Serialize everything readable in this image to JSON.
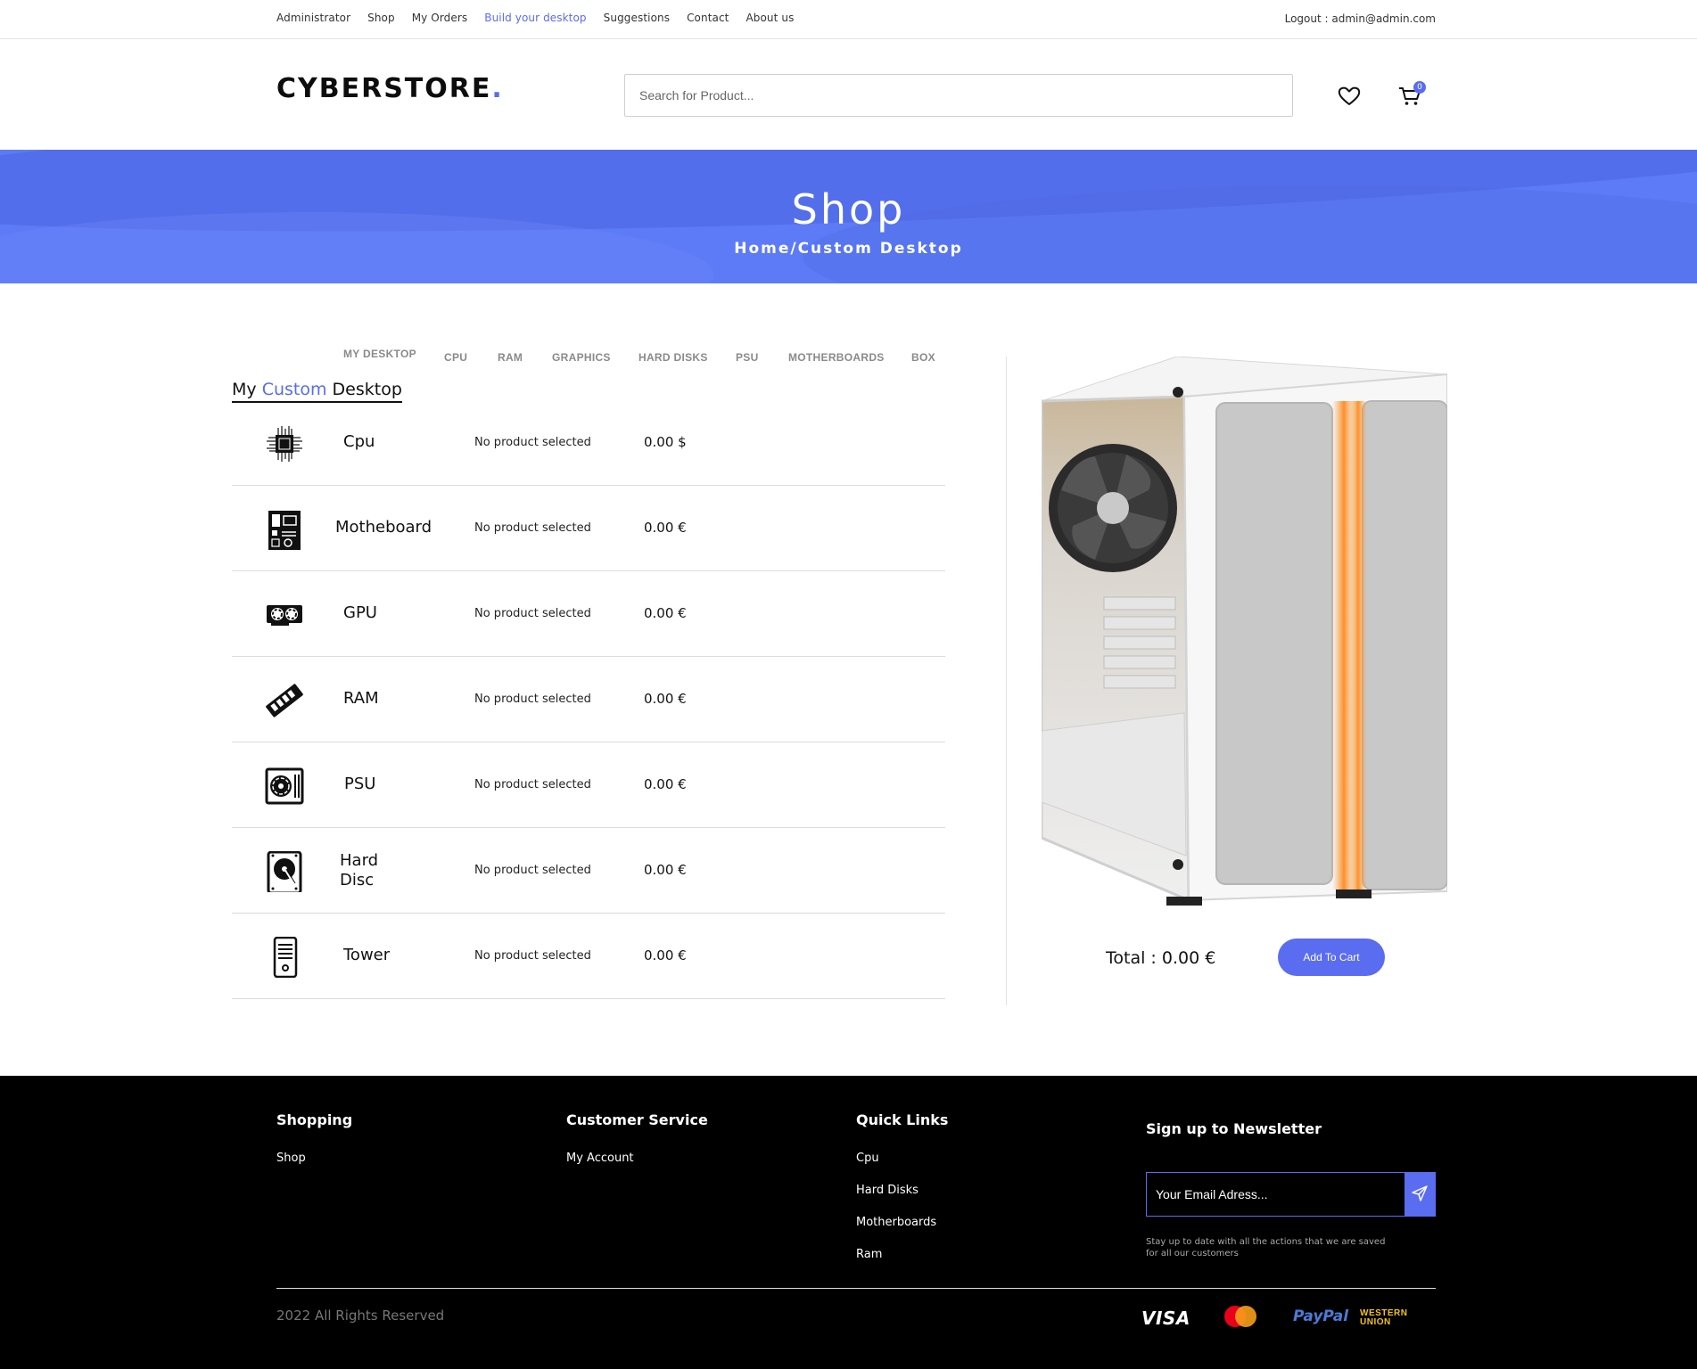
{
  "topnav": {
    "links": [
      "Administrator",
      "Shop",
      "My Orders",
      "Build your desktop",
      "Suggestions",
      "Contact",
      "About us"
    ],
    "active_index": 3,
    "logout": "Logout : admin@admin.com"
  },
  "header": {
    "logo_text": "CYBERSTORE",
    "logo_dot": ".",
    "search_placeholder": "Search for Product...",
    "cart_count": "0",
    "icons": {
      "wishlist": "heart-icon",
      "cart": "cart-icon"
    }
  },
  "banner": {
    "title": "Shop",
    "breadcrumb": "Home/Custom Desktop"
  },
  "tabs": [
    "MY DESKTOP",
    "CPU",
    "RAM",
    "GRAPHICS",
    "HARD DISKS",
    "PSU",
    "MOTHERBOARDS",
    "BOX"
  ],
  "builder": {
    "title_prefix": "My ",
    "title_accent": "Custom",
    "title_suffix": " Desktop",
    "components": [
      {
        "name": "Cpu",
        "icon": "cpu-icon",
        "product": "No product selected",
        "price": "0.00 $"
      },
      {
        "name": "Motheboard",
        "icon": "motherboard-icon",
        "product": "No product selected",
        "price": "0.00 €"
      },
      {
        "name": "GPU",
        "icon": "gpu-icon",
        "product": "No product selected",
        "price": "0.00 €"
      },
      {
        "name": "RAM",
        "icon": "ram-icon",
        "product": "No product selected",
        "price": "0.00 €"
      },
      {
        "name": "PSU",
        "icon": "psu-icon",
        "product": "No product selected",
        "price": "0.00 €"
      },
      {
        "name": "Hard Disc",
        "icon": "hard-disk-icon",
        "product": "No product selected",
        "price": "0.00 €"
      },
      {
        "name": "Tower",
        "icon": "tower-icon",
        "product": "No product selected",
        "price": "0.00 €"
      }
    ],
    "total": "Total : 0.00 €",
    "add_to_cart": "Add To Cart"
  },
  "footer": {
    "shopping": {
      "title": "Shopping",
      "links": [
        "Shop"
      ]
    },
    "customer_service": {
      "title": "Customer Service",
      "links": [
        "My Account"
      ]
    },
    "quick_links": {
      "title": "Quick Links",
      "links": [
        "Cpu",
        "Hard Disks",
        "Motherboards",
        "Ram"
      ]
    },
    "newsletter": {
      "title": "Sign up to Newsletter",
      "placeholder": "Your Email Adress...",
      "note": "Stay up to date with all the actions that we are saved for all our customers"
    },
    "copyright": "2022 All Rights Reserved",
    "payments": [
      "VISA",
      "MasterCard",
      "PayPal",
      "WESTERN UNION"
    ]
  },
  "colors": {
    "accent": "#5a6cf0",
    "banner": "#5d7bf7",
    "footer_bg": "#000000"
  }
}
